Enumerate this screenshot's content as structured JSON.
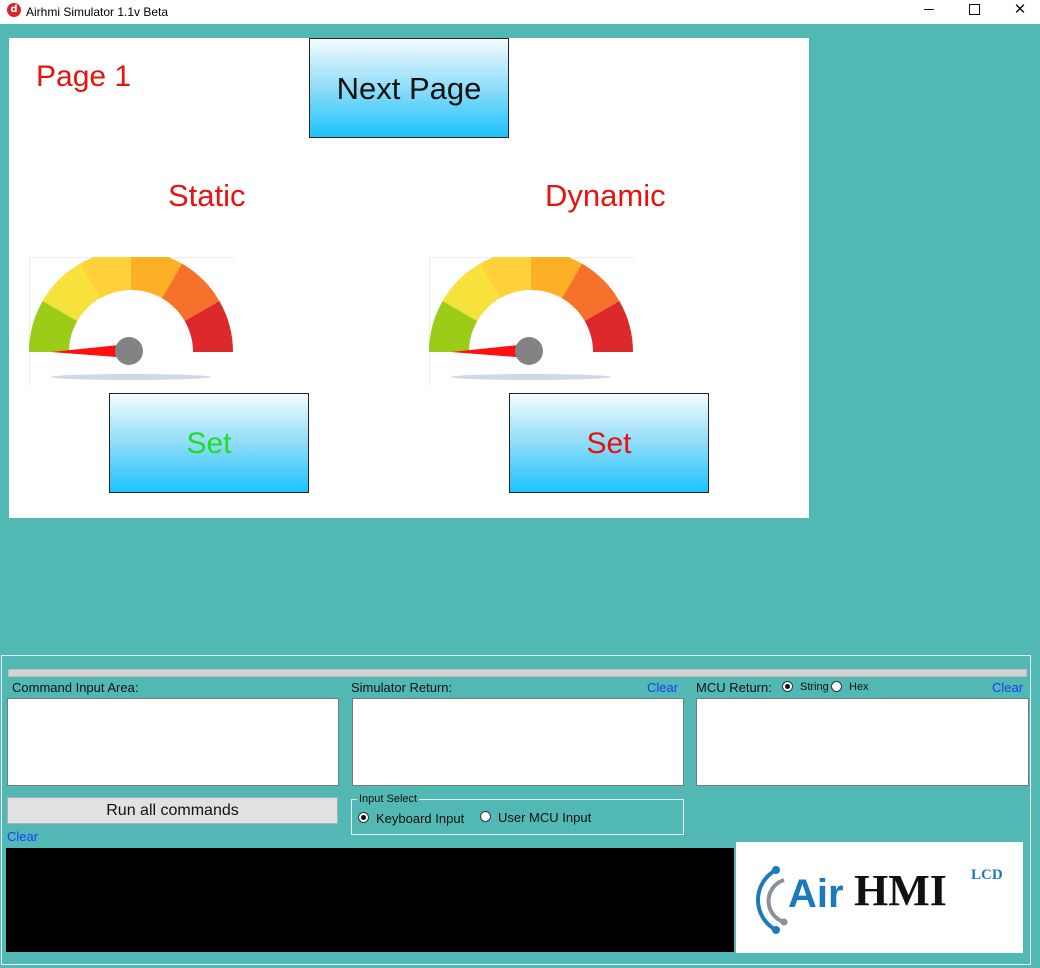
{
  "window": {
    "title": "Airhmi Simulator 1.1v Beta",
    "icon_glyph": "d",
    "controls": {
      "minimize": "minimize-icon",
      "maximize": "maximize-icon",
      "close": "✕"
    }
  },
  "hmi": {
    "page_label": "Page 1",
    "next_button": "Next Page",
    "static": {
      "title": "Static",
      "set_label": "Set",
      "set_color": "#22dd22",
      "needle_value": 0
    },
    "dynamic": {
      "title": "Dynamic",
      "set_label": "Set",
      "set_color": "#e8120f",
      "needle_value": 0
    },
    "colors": {
      "accent_text": "#e8120f",
      "button_gradient_top": "#f4fcff",
      "button_gradient_bottom": "#1cc3fc"
    }
  },
  "lower": {
    "command_input_label": "Command Input Area:",
    "simulator_return_label": "Simulator Return:",
    "simulator_clear": "Clear",
    "mcu_return_label": "MCU Return:",
    "mcu_format_options": [
      {
        "label": "String",
        "selected": true
      },
      {
        "label": "Hex",
        "selected": false
      }
    ],
    "mcu_clear": "Clear",
    "run_button": "Run all commands",
    "console_clear": "Clear",
    "input_select": {
      "legend": "Input Select",
      "options": [
        {
          "label": "Keyboard Input",
          "selected": true
        },
        {
          "label": "User MCU Input",
          "selected": false
        }
      ]
    },
    "logo": {
      "air": "Air",
      "hmi": "HMI",
      "sup": "LCD"
    }
  },
  "colors": {
    "background": "#52b8b3",
    "link": "#1a3cff"
  }
}
